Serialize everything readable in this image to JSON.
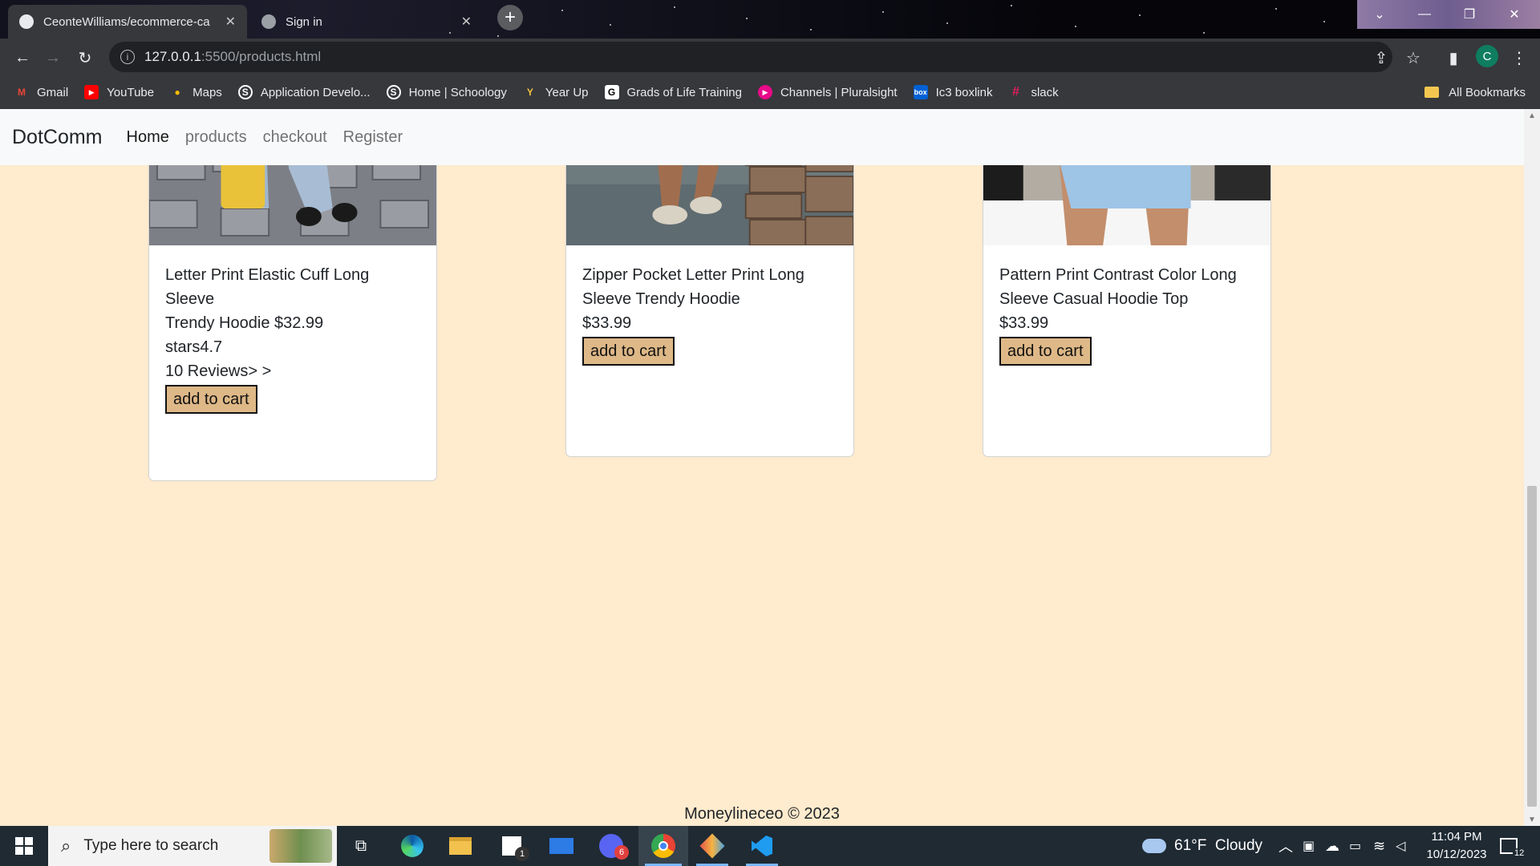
{
  "browser": {
    "tabs": [
      {
        "title": "CeonteWilliams/ecommerce-ca",
        "active": true
      },
      {
        "title": "Sign in",
        "active": false
      }
    ],
    "close_glyph": "✕",
    "new_tab_glyph": "+",
    "url_host": "127.0.0.1",
    "url_path": ":5500/products.html",
    "profile_initial": "C",
    "bookmarks": [
      {
        "label": "Gmail",
        "icon": "gmail-icon",
        "color": "#ea4335",
        "glyph": "M"
      },
      {
        "label": "YouTube",
        "icon": "youtube-icon",
        "color": "#ff0000",
        "glyph": "▶"
      },
      {
        "label": "Maps",
        "icon": "maps-icon",
        "color": "#34a853",
        "glyph": "⬤"
      },
      {
        "label": "Application Develo...",
        "icon": "schoology-icon",
        "color": "#36383c",
        "glyph": "S"
      },
      {
        "label": "Home | Schoology",
        "icon": "schoology-icon",
        "color": "#36383c",
        "glyph": "S"
      },
      {
        "label": "Year Up",
        "icon": "yearup-icon",
        "color": "#36383c",
        "glyph": "Y"
      },
      {
        "label": "Grads of Life Training",
        "icon": "grads-icon",
        "color": "#ffffff",
        "glyph": "G"
      },
      {
        "label": "Channels | Pluralsight",
        "icon": "pluralsight-icon",
        "color": "#e80a89",
        "glyph": "▸"
      },
      {
        "label": "Ic3 boxlink",
        "icon": "box-icon",
        "color": "#0061d5",
        "glyph": "box"
      },
      {
        "label": "slack",
        "icon": "slack-icon",
        "color": "#36383c",
        "glyph": "#"
      }
    ],
    "all_bookmarks": "All Bookmarks"
  },
  "site": {
    "brand": "DotComm",
    "nav": [
      {
        "label": "Home",
        "active": true
      },
      {
        "label": "products",
        "active": false
      },
      {
        "label": "checkout",
        "active": false
      },
      {
        "label": "Register",
        "active": false
      }
    ],
    "products": [
      {
        "name_line1": "Letter Print Elastic Cuff Long Sleeve",
        "name_line2": "Trendy Hoodie $32.99",
        "rating": "stars4.7",
        "reviews": "10 Reviews> >",
        "button": "add to cart"
      },
      {
        "name_line1": "Zipper Pocket Letter Print Long",
        "name_line2": "Sleeve Trendy Hoodie",
        "price": "$33.99",
        "button": "add to cart"
      },
      {
        "name_line1": "Pattern Print Contrast Color Long",
        "name_line2": "Sleeve Casual Hoodie Top",
        "price": "$33.99",
        "button": "add to cart"
      }
    ],
    "footer": "Moneylineceo © 2023"
  },
  "taskbar": {
    "search_placeholder": "Type here to search",
    "weather": "61°F  Cloudy",
    "time": "11:04 PM",
    "date": "10/12/2023",
    "notifications": "12",
    "mail_badge": "1",
    "discord_badge": "6"
  },
  "colors": {
    "page_bg": "#ffebcd",
    "button_bg": "#deb887",
    "navbar_bg": "#f8f9fa"
  }
}
